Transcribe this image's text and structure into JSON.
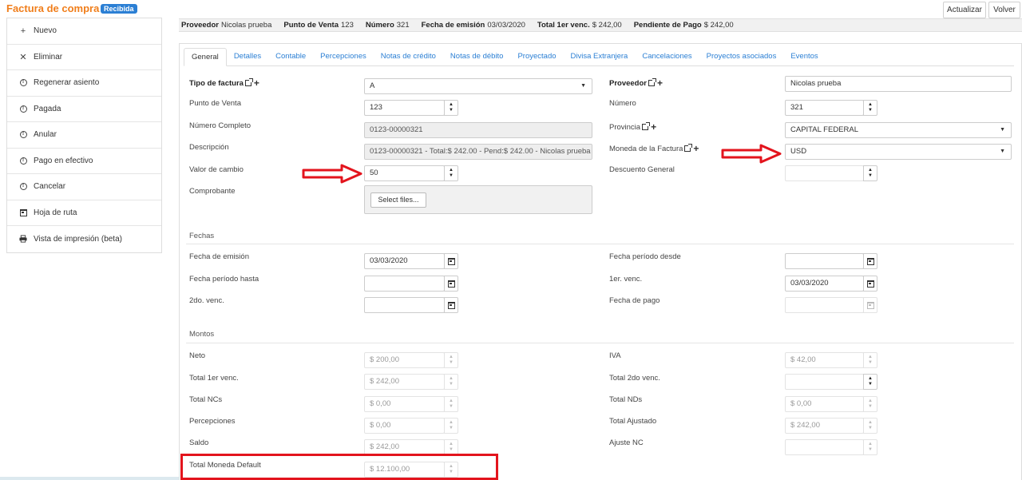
{
  "header": {
    "title": "Factura de compra",
    "status_badge": "Recibida",
    "refresh_label": "Actualizar",
    "back_label": "Volver"
  },
  "sidebar": {
    "items": [
      {
        "label": "Nuevo",
        "icon": "plus-icon"
      },
      {
        "label": "Eliminar",
        "icon": "close-icon"
      },
      {
        "label": "Regenerar asiento",
        "icon": "alert-circle-icon"
      },
      {
        "label": "Pagada",
        "icon": "alert-circle-icon"
      },
      {
        "label": "Anular",
        "icon": "alert-circle-icon"
      },
      {
        "label": "Pago en efectivo",
        "icon": "alert-circle-icon"
      },
      {
        "label": "Cancelar",
        "icon": "alert-circle-icon"
      },
      {
        "label": "Hoja de ruta",
        "icon": "calendar-icon"
      },
      {
        "label": "Vista de impresión (beta)",
        "icon": "printer-icon"
      }
    ]
  },
  "infobar": {
    "proveedor_label": "Proveedor",
    "proveedor_value": "Nicolas prueba",
    "punto_label": "Punto de Venta",
    "punto_value": "123",
    "numero_label": "Número",
    "numero_value": "321",
    "fecha_label": "Fecha de emisión",
    "fecha_value": "03/03/2020",
    "total_label": "Total 1er venc.",
    "total_value": "$ 242,00",
    "pendiente_label": "Pendiente de Pago",
    "pendiente_value": "$ 242,00"
  },
  "tabs": [
    "General",
    "Detalles",
    "Contable",
    "Percepciones",
    "Notas de crédito",
    "Notas de débito",
    "Proyectado",
    "Divisa Extranjera",
    "Cancelaciones",
    "Proyectos asociados",
    "Eventos"
  ],
  "form": {
    "tipo_factura": {
      "label": "Tipo de factura",
      "value": "A"
    },
    "punto_venta": {
      "label": "Punto de Venta",
      "value": "123"
    },
    "numero_completo": {
      "label": "Número Completo",
      "value": "0123-00000321"
    },
    "descripcion": {
      "label": "Descripción",
      "value": "0123-00000321 - Total:$ 242.00 - Pend:$ 242.00 - Nicolas prueba"
    },
    "valor_cambio": {
      "label": "Valor de cambio",
      "value": "50"
    },
    "comprobante": {
      "label": "Comprobante",
      "button": "Select files..."
    },
    "proveedor": {
      "label": "Proveedor",
      "value": "Nicolas prueba"
    },
    "numero": {
      "label": "Número",
      "value": "321"
    },
    "provincia": {
      "label": "Provincia",
      "value": "CAPITAL FEDERAL"
    },
    "moneda": {
      "label": "Moneda de la Factura",
      "value": "USD"
    },
    "descuento": {
      "label": "Descuento General",
      "value": ""
    }
  },
  "fechas": {
    "section": "Fechas",
    "emision": {
      "label": "Fecha de emisión",
      "value": "03/03/2020"
    },
    "periodo_hasta": {
      "label": "Fecha período hasta",
      "value": ""
    },
    "segundo_venc": {
      "label": "2do. venc.",
      "value": ""
    },
    "periodo_desde": {
      "label": "Fecha período desde",
      "value": ""
    },
    "primer_venc": {
      "label": "1er. venc.",
      "value": "03/03/2020"
    },
    "pago": {
      "label": "Fecha de pago",
      "value": ""
    }
  },
  "montos": {
    "section": "Montos",
    "neto": {
      "label": "Neto",
      "value": "$ 200,00"
    },
    "total_1er": {
      "label": "Total 1er venc.",
      "value": "$ 242,00"
    },
    "total_ncs": {
      "label": "Total NCs",
      "value": "$ 0,00"
    },
    "percepciones": {
      "label": "Percepciones",
      "value": "$ 0,00"
    },
    "saldo": {
      "label": "Saldo",
      "value": "$ 242,00"
    },
    "total_moneda_default": {
      "label": "Total Moneda Default",
      "value": "$ 12.100,00"
    },
    "iva": {
      "label": "IVA",
      "value": "$ 42,00"
    },
    "total_2do": {
      "label": "Total 2do venc.",
      "value": ""
    },
    "total_nds": {
      "label": "Total NDs",
      "value": "$ 0,00"
    },
    "total_ajustado": {
      "label": "Total Ajustado",
      "value": "$ 242,00"
    },
    "ajuste_nc": {
      "label": "Ajuste NC",
      "value": ""
    }
  },
  "colors": {
    "title": "#f07e1b",
    "badge": "#2b7fd4",
    "link": "#2b7fd4",
    "annotation": "#e3141d"
  }
}
